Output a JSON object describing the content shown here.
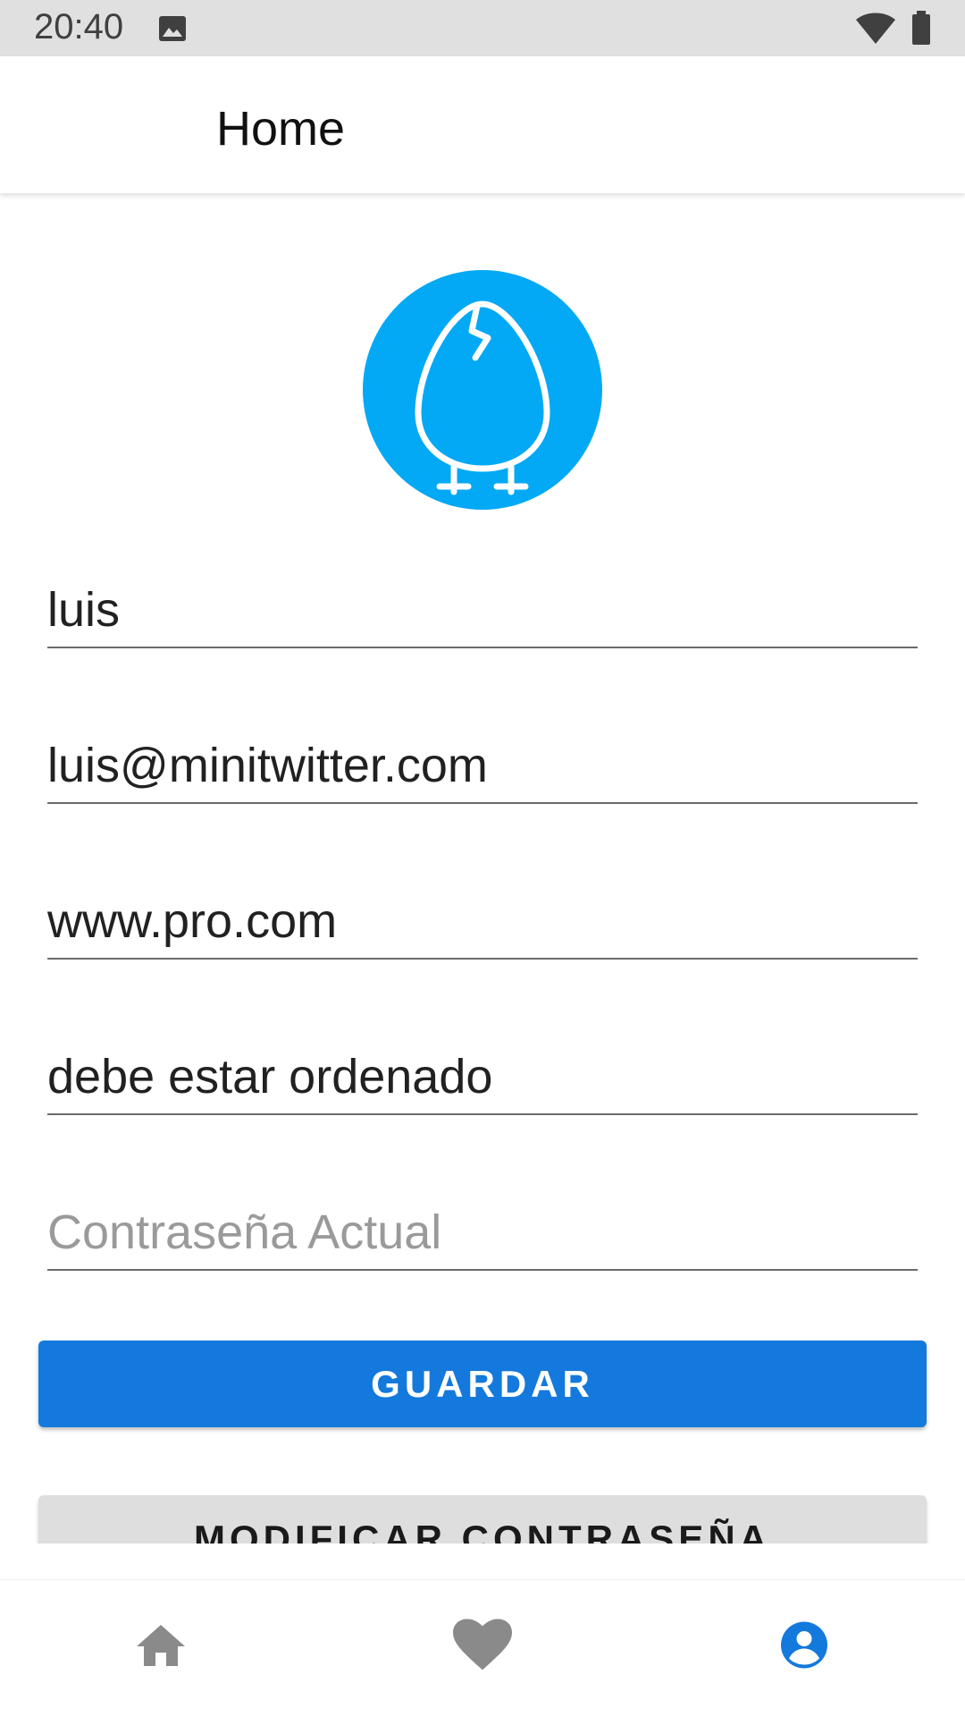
{
  "status_bar": {
    "time": "20:40",
    "icons": [
      "image-icon",
      "wifi-icon",
      "battery-icon"
    ]
  },
  "app_bar": {
    "title": "Home"
  },
  "profile": {
    "avatar_icon": "egg-chick-icon",
    "avatar_color": "#03a9f4"
  },
  "form": {
    "username": {
      "value": "luis",
      "placeholder": ""
    },
    "email": {
      "value": "luis@minitwitter.com",
      "placeholder": ""
    },
    "website": {
      "value": "www.pro.com",
      "placeholder": ""
    },
    "description": {
      "value": "debe estar ordenado",
      "placeholder": ""
    },
    "current_password": {
      "value": "",
      "placeholder": "Contraseña Actual"
    }
  },
  "buttons": {
    "save_label": "GUARDAR",
    "change_password_label": "MODIFICAR CONTRASEÑA"
  },
  "bottom_nav": {
    "items": [
      {
        "icon": "home-icon",
        "active": false
      },
      {
        "icon": "heart-icon",
        "active": false
      },
      {
        "icon": "account-circle-icon",
        "active": true
      }
    ],
    "active_color": "#1479dc",
    "inactive_color": "#8a8a8a"
  },
  "colors": {
    "primary": "#1479dc",
    "status_bar": "#e0e0e0"
  }
}
